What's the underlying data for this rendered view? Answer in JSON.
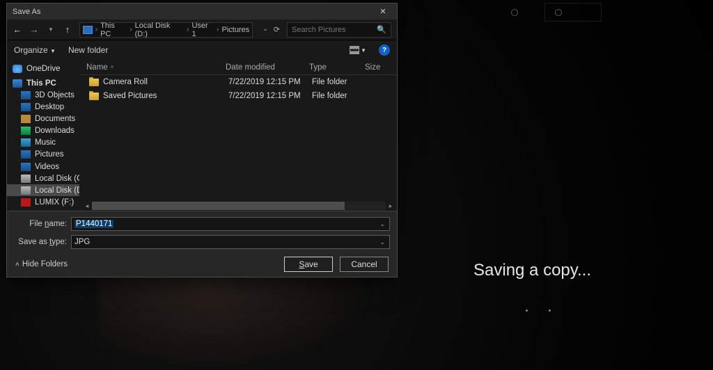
{
  "dialog": {
    "title": "Save As",
    "breadcrumb": [
      "This PC",
      "Local Disk (D:)",
      "User 1",
      "Pictures"
    ],
    "search_placeholder": "Search Pictures",
    "toolbar": {
      "organize": "Organize",
      "new_folder": "New folder"
    },
    "tree": [
      {
        "label": "OneDrive",
        "icon": "cloud"
      },
      {
        "label": "This PC",
        "icon": "pc",
        "bold": true
      },
      {
        "label": "3D Objects",
        "icon": "obj",
        "indent": true
      },
      {
        "label": "Desktop",
        "icon": "desk",
        "indent": true
      },
      {
        "label": "Documents",
        "icon": "doc",
        "indent": true
      },
      {
        "label": "Downloads",
        "icon": "dl",
        "indent": true
      },
      {
        "label": "Music",
        "icon": "music",
        "indent": true
      },
      {
        "label": "Pictures",
        "icon": "pic",
        "indent": true
      },
      {
        "label": "Videos",
        "icon": "vid",
        "indent": true
      },
      {
        "label": "Local Disk (C:)",
        "icon": "disk",
        "indent": true
      },
      {
        "label": "Local Disk (D:)",
        "icon": "disk",
        "indent": true,
        "selected": true
      },
      {
        "label": "LUMIX (F:)",
        "icon": "lumix",
        "indent": true
      }
    ],
    "columns": {
      "name": "Name",
      "date": "Date modified",
      "type": "Type",
      "size": "Size"
    },
    "rows": [
      {
        "name": "Camera Roll",
        "date": "7/22/2019 12:15 PM",
        "type": "File folder",
        "size": ""
      },
      {
        "name": "Saved Pictures",
        "date": "7/22/2019 12:15 PM",
        "type": "File folder",
        "size": ""
      }
    ],
    "form": {
      "filename_label": "File name:",
      "filename_value": "P1440171",
      "type_label": "Save as type:",
      "type_value": "JPG"
    },
    "footer": {
      "hide_folders": "Hide Folders",
      "save": "Save",
      "cancel": "Cancel"
    }
  },
  "background": {
    "saving_text": "Saving a copy..."
  }
}
